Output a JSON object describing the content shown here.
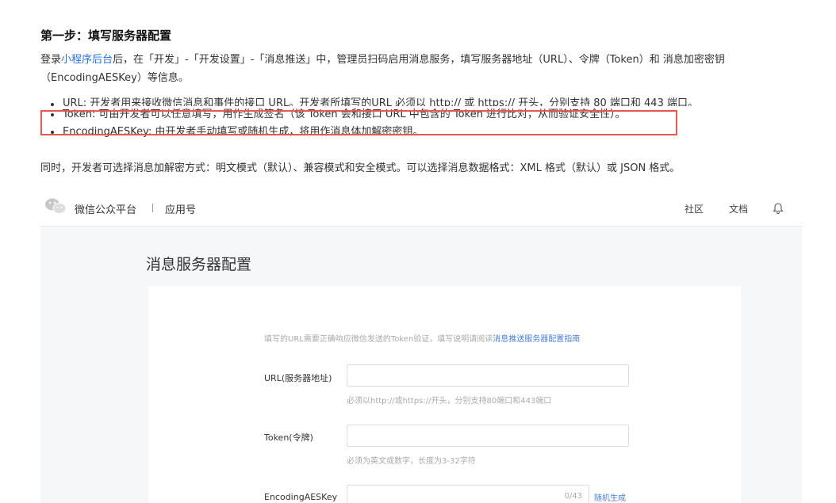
{
  "doc": {
    "step_title": "第一步：填写服务器配置",
    "intro_prefix": "登录",
    "intro_link": "小程序后台",
    "intro_line1_rest": "后，在「开发」-「开发设置」-「消息推送」中，管理员扫码启用消息服务，填写服务器地址（URL）、令牌（Token）和 消息加密密钥",
    "intro_line2": "（EncodingAESKey）等信息。",
    "bullets": [
      "URL: 开发者用来接收微信消息和事件的接口 URL。开发者所填写的URL 必须以 http:// 或 https:// 开头，分别支持 80 端口和 443 端口。",
      "Token: 可由开发者可以任意填写，用作生成签名（该 Token 会和接口 URL 中包含的 Token 进行比对，从而验证安全性）。",
      "EncodingAESKey: 由开发者手动填写或随机生成，将用作消息体加解密密钥。"
    ],
    "also_line": "同时，开发者可选择消息加解密方式：明文模式（默认）、兼容模式和安全模式。可以选择消息数据格式：XML 格式（默认）或 JSON 格式。"
  },
  "platform": {
    "brand": "微信公众平台",
    "app_name": "应用号",
    "nav": [
      "社区",
      "文档"
    ],
    "panel_title": "消息服务器配置",
    "notice_text": "填写的URL需要正确响应微信发送的Token验证，填写说明请阅读",
    "notice_link": "消息推送服务器配置指南",
    "fields": {
      "url_label": "URL(服务器地址)",
      "url_hint": "必须以http://或https://开头，分别支持80端口和443端口",
      "token_label": "Token(令牌)",
      "token_hint": "必须为英文或数字，长度为3-32字符",
      "aes_label": "EncodingAESKey",
      "aes_counter": "0/43",
      "aes_generate": "随机生成"
    }
  },
  "colors": {
    "highlight": "#e45a4f",
    "link": "#2a6fdb"
  }
}
